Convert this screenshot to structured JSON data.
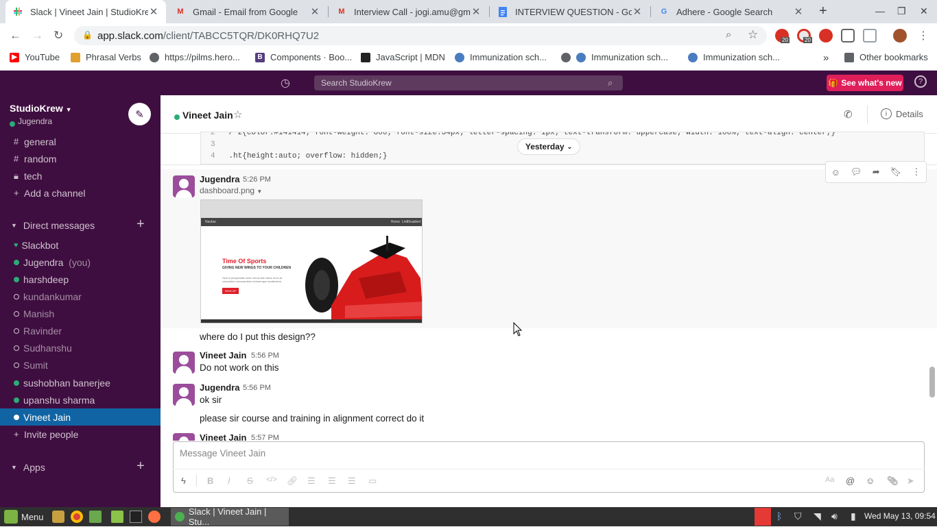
{
  "browser": {
    "tabs": [
      {
        "title": "Slack | Vineet Jain | StudioKrew",
        "active": true
      },
      {
        "title": "Gmail - Email from Google",
        "active": false
      },
      {
        "title": "Interview Call - jogi.amu@gmail",
        "active": false
      },
      {
        "title": "INTERVIEW QUESTION - Google",
        "active": false
      },
      {
        "title": "Adhere - Google Search",
        "active": false
      }
    ],
    "new_tab": "+",
    "url_host": "app.slack.com",
    "url_path": "/client/TABCC5TQR/DK0RHQ7U2",
    "ext_badges": [
      "20",
      "20"
    ],
    "bookmarks": [
      "YouTube",
      "Phrasal Verbs",
      "https://pilms.hero...",
      "Components · Boo...",
      "JavaScript | MDN",
      "Immunization sch...",
      "Immunization sch...",
      "Immunization sch..."
    ],
    "bookmarks_more": "»",
    "other_bookmarks": "Other bookmarks"
  },
  "slack": {
    "search_placeholder": "Search StudioKrew",
    "whats_new": "See what's new",
    "workspace": "StudioKrew",
    "current_user": "Jugendra",
    "channels": [
      "general",
      "random",
      "tech"
    ],
    "add_channel": "Add a channel",
    "dm_header": "Direct messages",
    "dms": [
      {
        "name": "Slackbot",
        "status": "bot"
      },
      {
        "name": "Jugendra",
        "suffix": "(you)",
        "status": "online"
      },
      {
        "name": "harshdeep",
        "status": "online"
      },
      {
        "name": "kundankumar",
        "status": "offline"
      },
      {
        "name": "Manish",
        "status": "offline"
      },
      {
        "name": "Ravinder",
        "status": "offline"
      },
      {
        "name": "Sudhanshu",
        "status": "offline"
      },
      {
        "name": "Sumit",
        "status": "offline"
      },
      {
        "name": "sushobhan banerjee",
        "status": "online"
      },
      {
        "name": "upanshu sharma",
        "status": "online"
      },
      {
        "name": "Vineet Jain",
        "status": "online",
        "active": true
      }
    ],
    "invite": "Invite people",
    "apps_header": "Apps",
    "channel_name": "Vineet Jain",
    "details": "Details",
    "code_lines": [
      {
        "num": "2",
        "text": "/*2{color:#141414; font-weight: 800; font-size:34px; letter-spacing: 1px; text-transform: uppercase; width: 100%; text-align: center;}"
      },
      {
        "num": "3",
        "text": ""
      },
      {
        "num": "4",
        "text": ".ht{height:auto; overflow: hidden;}"
      }
    ],
    "date_divider": "Yesterday",
    "messages": [
      {
        "author": "Jugendra",
        "time": "5:26 PM",
        "file": "dashboard.png",
        "text": "where do I put this design??"
      },
      {
        "author": "Vineet Jain",
        "time": "5:56 PM",
        "text": "Do not work on this"
      },
      {
        "author": "Jugendra",
        "time": "5:56 PM",
        "text": "ok sir",
        "text2": "please sir course and training in alignment correct do it"
      },
      {
        "author": "Vineet Jain",
        "time": "5:57 PM"
      }
    ],
    "preview": {
      "nav": "Navbar",
      "nav_links": [
        "Home",
        "Link",
        "Disabled"
      ],
      "brand": "Time Of Sports",
      "tagline": "GIVING NEW WINGS TO YOUR CHILDREN",
      "body": "Sed ut perspiciatis unde omnis iste natus error sit voluptatem accusantium doloremque laudantium.",
      "cta": "SIGN UP"
    },
    "composer_placeholder": "Message Vineet Jain"
  },
  "taskbar": {
    "menu": "Menu",
    "task": "Slack | Vineet Jain | Stu...",
    "clock": "Wed May 13, 09:54"
  },
  "colors": {
    "aubergine": "#3f0e40",
    "active": "#1164a3",
    "online": "#2bac76",
    "accent": "#e01e5a"
  }
}
